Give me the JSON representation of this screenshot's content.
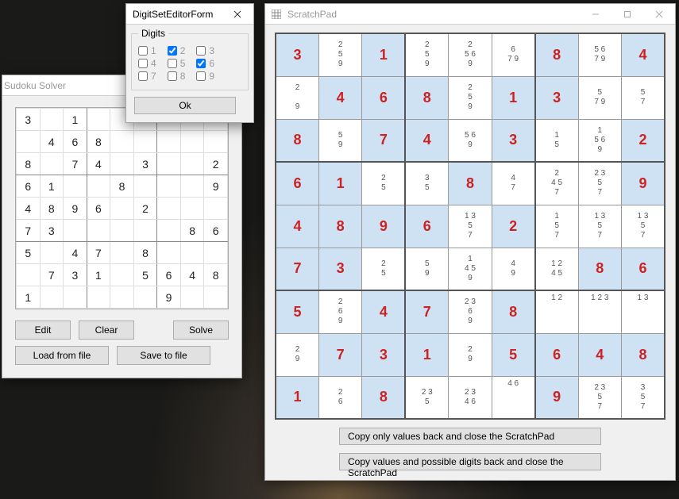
{
  "solver": {
    "title": "Sudoku Solver",
    "buttons": {
      "edit": "Edit",
      "clear": "Clear",
      "solve": "Solve",
      "load": "Load from file",
      "save": "Save to file"
    },
    "grid": [
      [
        "3",
        "",
        "1",
        "",
        "",
        "",
        "",
        "",
        ""
      ],
      [
        "",
        "4",
        "6",
        "8",
        "",
        "",
        "",
        "",
        ""
      ],
      [
        "8",
        "",
        "7",
        "4",
        "",
        "3",
        "",
        "",
        "2"
      ],
      [
        "6",
        "1",
        "",
        "",
        "8",
        "",
        "",
        "",
        "9"
      ],
      [
        "4",
        "8",
        "9",
        "6",
        "",
        "2",
        "",
        "",
        ""
      ],
      [
        "7",
        "3",
        "",
        "",
        "",
        "",
        "",
        "8",
        "6"
      ],
      [
        "5",
        "",
        "4",
        "7",
        "",
        "8",
        "",
        "",
        ""
      ],
      [
        "",
        "7",
        "3",
        "1",
        "",
        "5",
        "6",
        "4",
        "8"
      ],
      [
        "1",
        "",
        "",
        "",
        "",
        "",
        "9",
        "",
        ""
      ]
    ]
  },
  "digitset": {
    "title": "DigitSetEditorForm",
    "legend": "Digits",
    "ok": "Ok",
    "items": [
      {
        "label": "1",
        "checked": false
      },
      {
        "label": "2",
        "checked": true
      },
      {
        "label": "3",
        "checked": false
      },
      {
        "label": "4",
        "checked": false
      },
      {
        "label": "5",
        "checked": false
      },
      {
        "label": "6",
        "checked": true
      },
      {
        "label": "7",
        "checked": false
      },
      {
        "label": "8",
        "checked": false
      },
      {
        "label": "9",
        "checked": false
      }
    ]
  },
  "scratch": {
    "title": "ScratchPad",
    "copy_values": "Copy only values back and close the ScratchPad",
    "copy_all": "Copy values and possible digits back and close the ScratchPad",
    "grid": [
      [
        {
          "v": "3",
          "blue": true
        },
        {
          "c": "2\n5\n9"
        },
        {
          "v": "1",
          "blue": true
        },
        {
          "c": "2\n5\n9"
        },
        {
          "c": "2\n5 6\n9"
        },
        {
          "c": "6\n7 9"
        },
        {
          "v": "8",
          "blue": true
        },
        {
          "c": "5 6\n7 9"
        },
        {
          "v": "4",
          "blue": true
        }
      ],
      [
        {
          "c": "2\n\n9"
        },
        {
          "v": "4",
          "blue": true
        },
        {
          "v": "6",
          "blue": true
        },
        {
          "v": "8",
          "blue": true
        },
        {
          "c": "2\n5\n9"
        },
        {
          "v": "1",
          "blue": true
        },
        {
          "v": "3",
          "blue": true
        },
        {
          "c": "5\n7 9"
        },
        {
          "c": "5\n7"
        }
      ],
      [
        {
          "v": "8",
          "blue": true
        },
        {
          "c": "5\n9"
        },
        {
          "v": "7",
          "blue": true
        },
        {
          "v": "4",
          "blue": true
        },
        {
          "c": "5 6\n9"
        },
        {
          "v": "3",
          "blue": true
        },
        {
          "c": "1\n5"
        },
        {
          "c": "1\n5 6\n9"
        },
        {
          "v": "2",
          "blue": true
        }
      ],
      [
        {
          "v": "6",
          "blue": true
        },
        {
          "v": "1",
          "blue": true
        },
        {
          "c": "2\n5"
        },
        {
          "c": "3\n5"
        },
        {
          "v": "8",
          "blue": true
        },
        {
          "c": "4\n7"
        },
        {
          "c": "2\n4 5\n7"
        },
        {
          "c": "2 3\n5\n7"
        },
        {
          "v": "9",
          "blue": true
        }
      ],
      [
        {
          "v": "4",
          "blue": true
        },
        {
          "v": "8",
          "blue": true
        },
        {
          "v": "9",
          "blue": true
        },
        {
          "v": "6",
          "blue": true
        },
        {
          "c": "1 3\n5\n7"
        },
        {
          "v": "2",
          "blue": true
        },
        {
          "c": "1\n5\n7"
        },
        {
          "c": "1 3\n5\n7"
        },
        {
          "c": "1 3\n5\n7"
        }
      ],
      [
        {
          "v": "7",
          "blue": true
        },
        {
          "v": "3",
          "blue": true
        },
        {
          "c": "2\n5"
        },
        {
          "c": "5\n9"
        },
        {
          "c": "1\n4 5\n9"
        },
        {
          "c": "4\n9"
        },
        {
          "c": "1 2\n4 5"
        },
        {
          "v": "8",
          "blue": true
        },
        {
          "v": "6",
          "blue": true
        }
      ],
      [
        {
          "v": "5",
          "blue": true
        },
        {
          "c": "2\n6\n9"
        },
        {
          "v": "4",
          "blue": true
        },
        {
          "v": "7",
          "blue": true
        },
        {
          "c": "2 3\n6\n9"
        },
        {
          "v": "8",
          "blue": true
        },
        {
          "c": "1 2"
        },
        {
          "c": "1 2 3"
        },
        {
          "c": "1 3"
        }
      ],
      [
        {
          "c": "2\n9"
        },
        {
          "v": "7",
          "blue": true
        },
        {
          "v": "3",
          "blue": true
        },
        {
          "v": "1",
          "blue": true
        },
        {
          "c": "2\n9"
        },
        {
          "v": "5",
          "blue": true
        },
        {
          "v": "6",
          "blue": true
        },
        {
          "v": "4",
          "blue": true
        },
        {
          "v": "8",
          "blue": true
        }
      ],
      [
        {
          "v": "1",
          "blue": true
        },
        {
          "c": "2\n6"
        },
        {
          "v": "8",
          "blue": true
        },
        {
          "c": "2 3\n5"
        },
        {
          "c": "2 3\n4 6"
        },
        {
          "c": "4 6"
        },
        {
          "v": "9",
          "blue": true
        },
        {
          "c": "2 3\n5\n7"
        },
        {
          "c": "3\n5\n7"
        }
      ]
    ]
  }
}
